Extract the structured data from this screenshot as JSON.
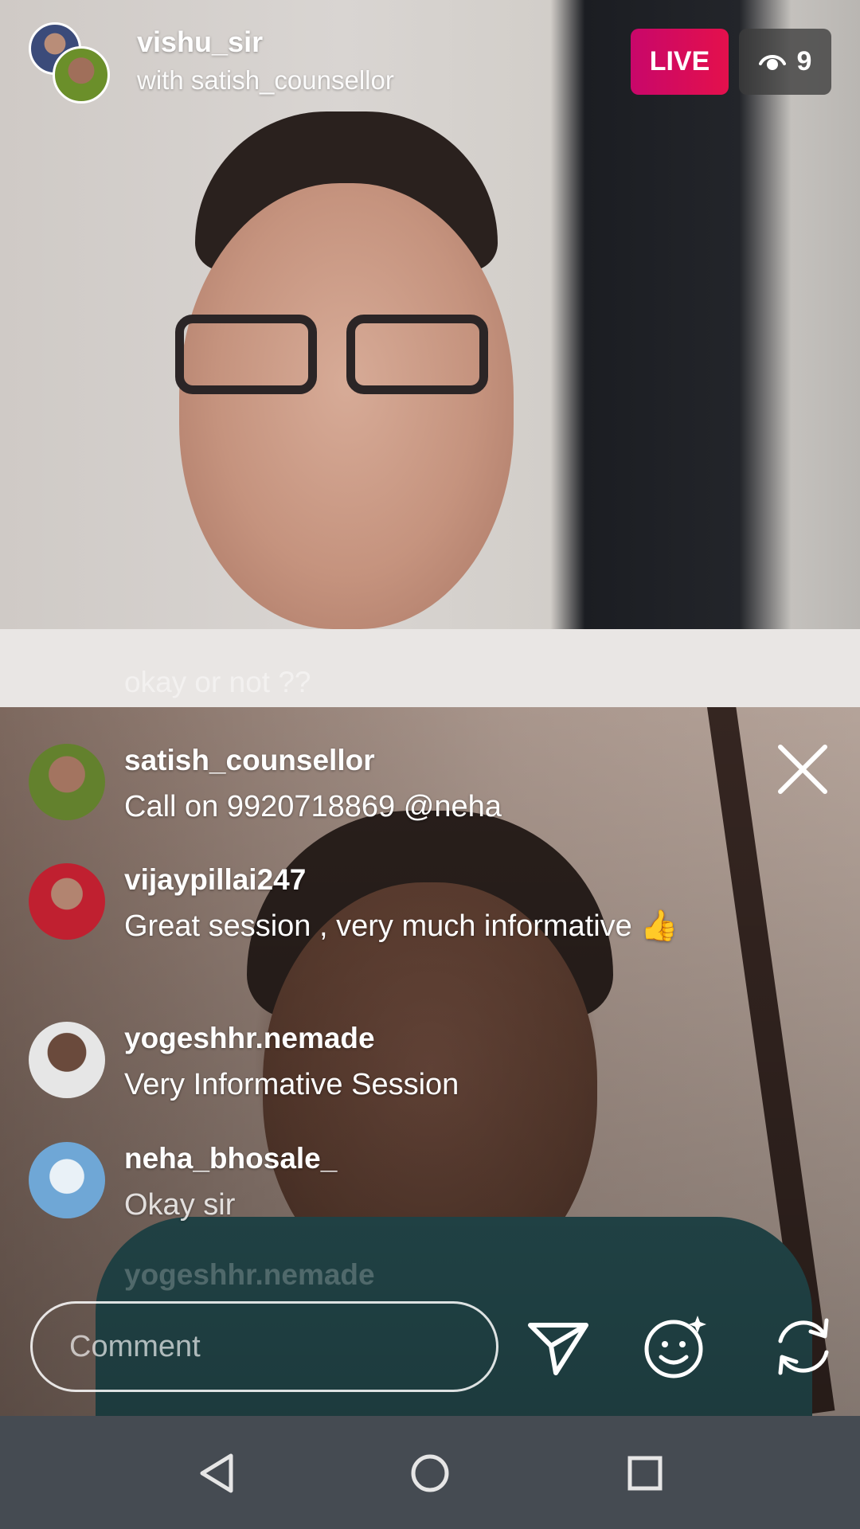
{
  "header": {
    "host_name": "vishu_sir",
    "guest_line": "with satish_counsellor",
    "live_label": "LIVE",
    "viewer_count": "9"
  },
  "overlay_comment": "okay or not ??",
  "comments": [
    {
      "user": "satish_counsellor",
      "text": "Call on 9920718869 @neha"
    },
    {
      "user": "vijaypillai247",
      "text": "Great session , very much informative 👍"
    },
    {
      "user": "yogeshhr.nemade",
      "text": "Very Informative Session"
    },
    {
      "user": "neha_bhosale_",
      "text": "Okay sir"
    }
  ],
  "ghost_comment": "yogeshhr.nemade",
  "composer": {
    "placeholder": "Comment"
  },
  "icons": {
    "close": "close-icon",
    "send": "send-icon",
    "effects": "face-effects-icon",
    "flip": "flip-camera-icon",
    "viewers": "eye-icon",
    "nav_back": "back-icon",
    "nav_home": "home-icon",
    "nav_recents": "recents-icon"
  },
  "colors": {
    "live_gradient_start": "#c8076a",
    "live_gradient_end": "#e4104c",
    "navbar": "#454b52"
  }
}
